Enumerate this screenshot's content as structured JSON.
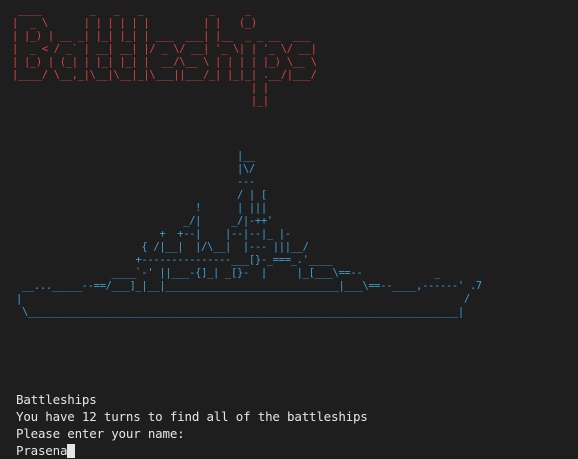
{
  "banner_art": " ____        _   _   _           _     _           \n|  _ \\      | | | | | |         | |   (_)          \n| |_) | __ _| |_| |_| | ___  ___| |__  _ _ __  ___ \n|  _ < / _` | __| __| |/ _ \\/ __| '_ \\| | '_ \\/ __|\n| |_) | (_| | |_| |_| |  __/\\__ \\ | | | | |_) \\__ \\\n|____/ \\__,_|\\__|\\__|_|\\___||___/_| |_|_| .__/|___/\n                                        | |        \n                                        |_|        ",
  "ship_art": "                                     |__\n                                     |\\/\n                                     ---\n                                     / | [\n                              !      | |||\n                            _/|     _/|-++'\n                        +  +--|    |--|--|_ |-\n                     { /|__|  |/\\__|  |--- |||__/\n                    +---------------___[}-_===_.'____\n                ____`-' ||___-{]_| _[}-  |     |_[___\\==--            _\n __..._____--==/___]_|__|_____________________________|___\\==--____,------' .7\n|                                                                          /\n \\________________________________________________________________________|",
  "output": {
    "title": "Battleships",
    "turns_message": "You have 12 turns to find all of the battleships",
    "name_prompt": "Please enter your name:",
    "name_value": "Prasena"
  },
  "colors": {
    "background": "#1e1e1e",
    "banner": "#e04040",
    "ship": "#3a9fd6",
    "text": "#e6e6e6"
  }
}
